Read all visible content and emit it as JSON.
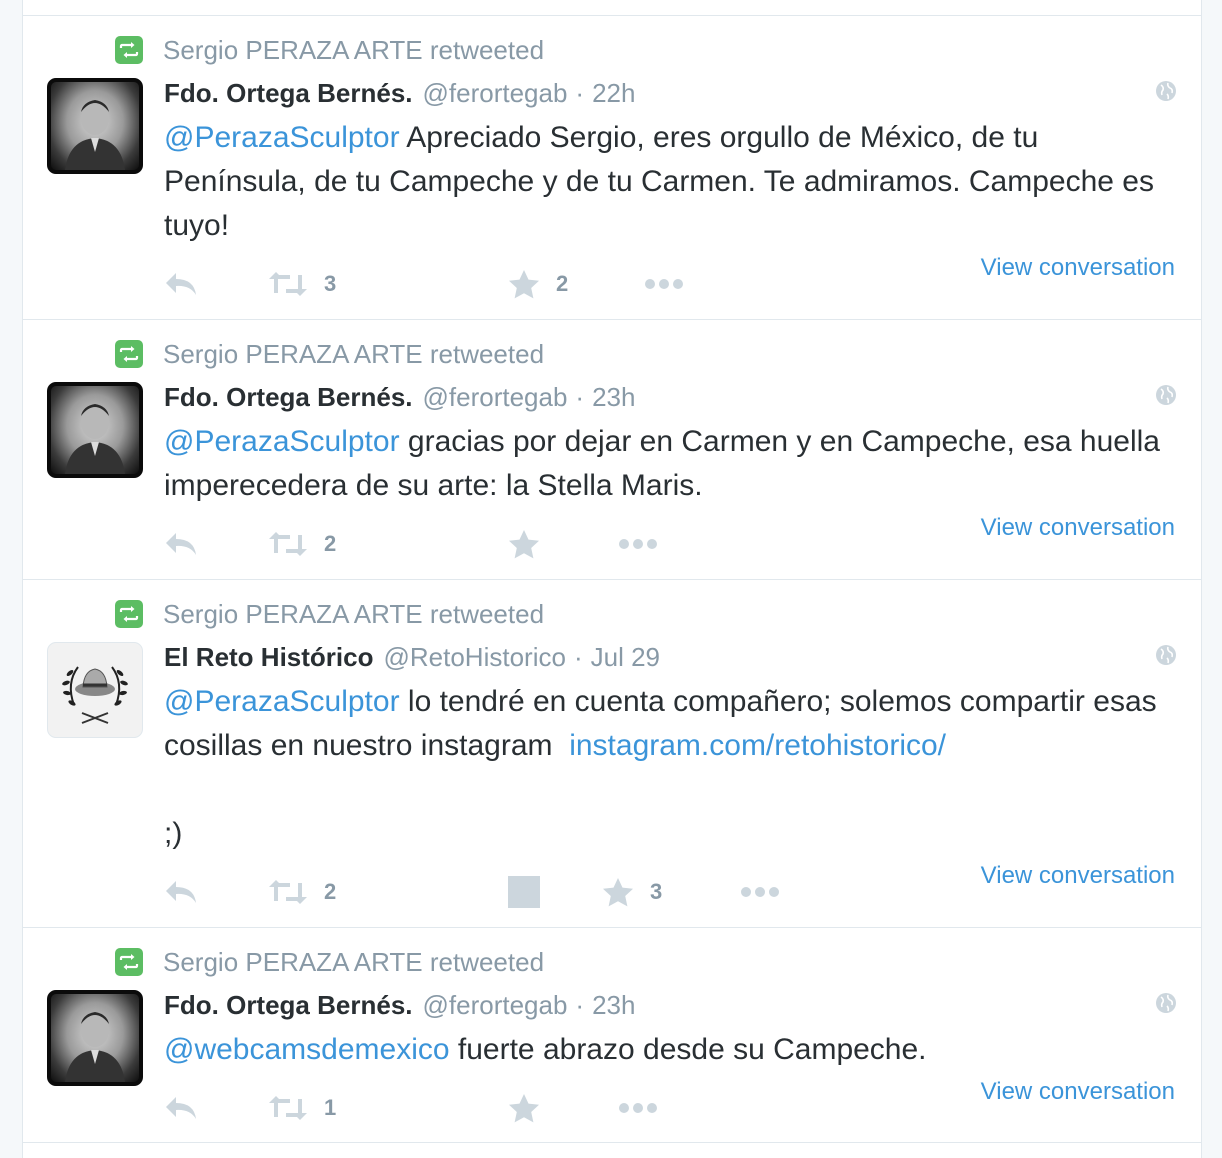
{
  "tweets": [
    {
      "retweeted_by": "Sergio PERAZA ARTE retweeted",
      "fullname": "Fdo. Ortega Bernés.",
      "screenname": "@ferortegab",
      "separator": "·",
      "time": "22h",
      "text_parts": [
        {
          "type": "mention",
          "text": "@PerazaSculptor"
        },
        {
          "type": "text",
          "text": " Apreciado Sergio, eres orgullo de México, de tu Península, de tu Campeche y de tu Carmen. Te admiramos. Campeche es tuyo!"
        }
      ],
      "retweet_count": "3",
      "favorite_count": "2",
      "view_conversation": "View conversation",
      "avatar_icon": "profile-photo-man-grayscale"
    },
    {
      "retweeted_by": "Sergio PERAZA ARTE retweeted",
      "fullname": "Fdo. Ortega Bernés.",
      "screenname": "@ferortegab",
      "separator": "·",
      "time": "23h",
      "text_parts": [
        {
          "type": "mention",
          "text": "@PerazaSculptor"
        },
        {
          "type": "text",
          "text": " gracias por dejar en Carmen y en Campeche, esa huella imperecedera de su arte: la Stella Maris."
        }
      ],
      "retweet_count": "2",
      "favorite_count": "",
      "view_conversation": "View conversation",
      "avatar_icon": "profile-photo-man-grayscale"
    },
    {
      "retweeted_by": "Sergio PERAZA ARTE retweeted",
      "fullname": "El Reto Histórico",
      "screenname": "@RetoHistorico",
      "separator": "·",
      "time": "Jul 29",
      "text_parts": [
        {
          "type": "mention",
          "text": "@PerazaSculptor"
        },
        {
          "type": "text",
          "text": " lo tendré en cuenta compañero; solemos compartir esas cosillas en nuestro instagram  "
        },
        {
          "type": "link",
          "text": "instagram.com/retohistorico/"
        }
      ],
      "text_extra": ";)",
      "retweet_count": "2",
      "favorite_count": "3",
      "view_conversation": "View conversation",
      "avatar_icon": "hat-laurel-logo"
    },
    {
      "retweeted_by": "Sergio PERAZA ARTE retweeted",
      "fullname": "Fdo. Ortega Bernés.",
      "screenname": "@ferortegab",
      "separator": "·",
      "time": "23h",
      "text_parts": [
        {
          "type": "mention",
          "text": "@webcamsdemexico"
        },
        {
          "type": "text",
          "text": " fuerte abrazo desde su Campeche."
        }
      ],
      "retweet_count": "1",
      "favorite_count": "",
      "view_conversation": "View conversation",
      "avatar_icon": "profile-photo-man-grayscale"
    }
  ],
  "colors": {
    "link": "#3b94d9",
    "muted": "#8899a6",
    "retweet_badge": "#5cbd63",
    "icon": "#ccd6dd"
  }
}
